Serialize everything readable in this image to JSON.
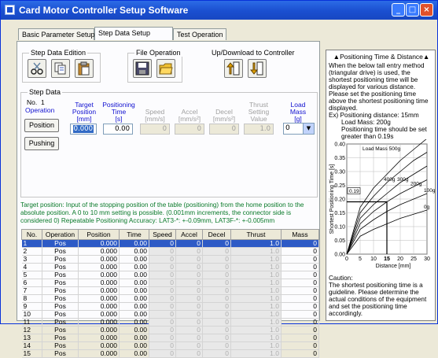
{
  "window": {
    "title": "Card Motor Controller Setup Software"
  },
  "tabs": [
    {
      "label": "Basic Parameter Setup"
    },
    {
      "label": "Step Data Setup"
    },
    {
      "label": "Test Operation"
    }
  ],
  "groups": {
    "step_edit": "Step Data Edition",
    "file_op": "File Operation",
    "updown": "Up/Download to Controller",
    "step_data": "Step Data"
  },
  "step_form": {
    "no_label": "No.",
    "no_value": "1",
    "operation_label": "Operation",
    "position_btn": "Position",
    "pushing_btn": "Pushing",
    "headers": {
      "target_position": [
        "Target",
        "Position",
        "[mm]"
      ],
      "positioning_time": [
        "Positioning",
        "Time",
        "[s]"
      ],
      "speed": [
        "Speed",
        "[mm/s]"
      ],
      "accel": [
        "Accel",
        "[mm/s²]"
      ],
      "decel": [
        "Decel",
        "[mm/s²]"
      ],
      "thrust": [
        "Thrust",
        "Setting",
        "Value"
      ],
      "load_mass": [
        "Load",
        "Mass",
        "[g]"
      ]
    },
    "values": {
      "target_position": "0.000",
      "positioning_time": "0.00",
      "speed": "0",
      "accel": "0",
      "decel": "0",
      "thrust": "1.0",
      "load_mass": "0"
    }
  },
  "info_text": "Target position: Input of the stopping position of the table (positioning) from the home position to the absolute position. A 0 to 10 mm setting is possible. (0.001mm increments, the connector side is considered 0)  Repeatable Positioning Accuracy: LAT3-*: +-0.09mm, LAT3F-*: +-0.005mm",
  "table": {
    "columns": [
      "No.",
      "Operation",
      "Position",
      "Time",
      "Speed",
      "Accel",
      "Decel",
      "Thrust",
      "Mass"
    ],
    "rows": [
      [
        "1",
        "Pos",
        "0.000",
        "0.00",
        "0",
        "0",
        "0",
        "1.0",
        "0"
      ],
      [
        "2",
        "Pos",
        "0.000",
        "0.00",
        "0",
        "0",
        "0",
        "1.0",
        "0"
      ],
      [
        "3",
        "Pos",
        "0.000",
        "0.00",
        "0",
        "0",
        "0",
        "1.0",
        "0"
      ],
      [
        "4",
        "Pos",
        "0.000",
        "0.00",
        "0",
        "0",
        "0",
        "1.0",
        "0"
      ],
      [
        "5",
        "Pos",
        "0.000",
        "0.00",
        "0",
        "0",
        "0",
        "1.0",
        "0"
      ],
      [
        "6",
        "Pos",
        "0.000",
        "0.00",
        "0",
        "0",
        "0",
        "1.0",
        "0"
      ],
      [
        "7",
        "Pos",
        "0.000",
        "0.00",
        "0",
        "0",
        "0",
        "1.0",
        "0"
      ],
      [
        "8",
        "Pos",
        "0.000",
        "0.00",
        "0",
        "0",
        "0",
        "1.0",
        "0"
      ],
      [
        "9",
        "Pos",
        "0.000",
        "0.00",
        "0",
        "0",
        "0",
        "1.0",
        "0"
      ],
      [
        "10",
        "Pos",
        "0.000",
        "0.00",
        "0",
        "0",
        "0",
        "1.0",
        "0"
      ],
      [
        "11",
        "Pos",
        "0.000",
        "0.00",
        "0",
        "0",
        "0",
        "1.0",
        "0"
      ],
      [
        "12",
        "Pos",
        "0.000",
        "0.00",
        "0",
        "0",
        "0",
        "1.0",
        "0"
      ],
      [
        "13",
        "Pos",
        "0.000",
        "0.00",
        "0",
        "0",
        "0",
        "1.0",
        "0"
      ],
      [
        "14",
        "Pos",
        "0.000",
        "0.00",
        "0",
        "0",
        "0",
        "1.0",
        "0"
      ],
      [
        "15",
        "Pos",
        "0.000",
        "0.00",
        "0",
        "0",
        "0",
        "1.0",
        "0"
      ]
    ]
  },
  "guide": {
    "title": "▲Positioning Time & Distance▲",
    "desc": "When the below tall entry method (triangular drive) is used, the shortest positioning time will be displayed for various distance. Please set the positioning time above the shortest positioning time displayed.",
    "ex1": "Ex) Positioning distance: 15mm",
    "ex2": "Load Mass: 200g",
    "ex3": "Positioning time should be set greater than 0.19s",
    "caution_label": "Caution:",
    "caution": "The shortest positioning time is a guideline. Please determine the actual conditions of the equipment and set the positioning time accordingly."
  },
  "chart_data": {
    "type": "line",
    "xlabel": "Distance [mm]",
    "ylabel": "Shortest Positioning Time [s]",
    "xlim": [
      0,
      30
    ],
    "ylim": [
      0,
      0.4
    ],
    "x_ticks": [
      "0",
      "5",
      "10",
      "15",
      "20",
      "25",
      "30"
    ],
    "y_ticks": [
      "0.00",
      "0.05",
      "0.10",
      "0.15",
      "0.20",
      "0.25",
      "0.30",
      "0.35",
      "0.40"
    ],
    "series": [
      {
        "name": "Load Mass 500g",
        "x": [
          0,
          5,
          10,
          15,
          20,
          25,
          30
        ],
        "y": [
          0,
          0.17,
          0.24,
          0.29,
          0.34,
          0.38,
          0.42
        ]
      },
      {
        "name": "400g",
        "x": [
          0,
          5,
          10,
          15,
          20,
          25,
          30
        ],
        "y": [
          0,
          0.15,
          0.21,
          0.26,
          0.3,
          0.34,
          0.37
        ]
      },
      {
        "name": "300g",
        "x": [
          0,
          5,
          10,
          15,
          20,
          25,
          30
        ],
        "y": [
          0,
          0.13,
          0.18,
          0.22,
          0.26,
          0.29,
          0.32
        ]
      },
      {
        "name": "200g",
        "x": [
          0,
          5,
          10,
          15,
          20,
          25,
          30
        ],
        "y": [
          0,
          0.11,
          0.155,
          0.19,
          0.22,
          0.245,
          0.27
        ]
      },
      {
        "name": "100g",
        "x": [
          0,
          5,
          10,
          15,
          20,
          25,
          30
        ],
        "y": [
          0,
          0.09,
          0.125,
          0.155,
          0.18,
          0.2,
          0.22
        ]
      },
      {
        "name": "0g",
        "x": [
          0,
          5,
          10,
          15,
          20,
          25,
          30
        ],
        "y": [
          0,
          0.065,
          0.09,
          0.11,
          0.13,
          0.145,
          0.16
        ]
      }
    ],
    "annotations": [
      {
        "text": "0.19",
        "y": 0.19
      },
      {
        "text": "15",
        "x": 15
      }
    ]
  }
}
